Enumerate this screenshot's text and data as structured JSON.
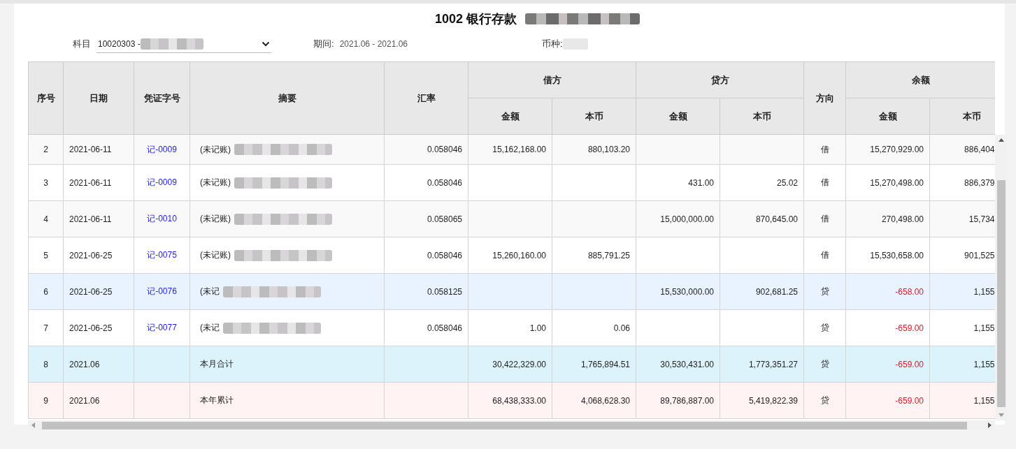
{
  "title": {
    "text": "1002 银行存款",
    "blurred": true
  },
  "filters": {
    "subject_label": "科目",
    "subject_value": "10020303 -",
    "subject_blurred": true,
    "period_label": "期间:",
    "period_value": "2021.06 - 2021.06",
    "currency_label": "币种:",
    "currency_blurred": true
  },
  "table": {
    "header": [
      {
        "label": "序号"
      },
      {
        "label": "日期"
      },
      {
        "label": "凭证字号"
      },
      {
        "label": "摘要"
      },
      {
        "label": "汇率"
      },
      {
        "label": "借方",
        "children": [
          "金额",
          "本币"
        ]
      },
      {
        "label": "贷方",
        "children": [
          "金额",
          "本币"
        ]
      },
      {
        "label": "方向"
      },
      {
        "label": "余额",
        "children": [
          "金额",
          "本币"
        ]
      }
    ],
    "rows": [
      {
        "kind": "entry",
        "selected": false,
        "no": "2",
        "date": "2021-06-11",
        "voucher": "记-0009",
        "summary": "(未记账)",
        "summary_blurred": true,
        "rate": "0.058046",
        "debit_amount": "15,162,168.00",
        "debit_base": "880,103.20",
        "credit_amount": "",
        "credit_base": "",
        "direction": "借",
        "balance_amount": "15,270,929.00",
        "balance_negative": false,
        "balance_base": "886,404"
      },
      {
        "kind": "entry",
        "selected": false,
        "no": "3",
        "date": "2021-06-11",
        "voucher": "记-0009",
        "summary": "(未记账)",
        "summary_blurred": true,
        "rate": "0.058046",
        "debit_amount": "",
        "debit_base": "",
        "credit_amount": "431.00",
        "credit_base": "25.02",
        "direction": "借",
        "balance_amount": "15,270,498.00",
        "balance_negative": false,
        "balance_base": "886,379"
      },
      {
        "kind": "entry",
        "selected": false,
        "no": "4",
        "date": "2021-06-11",
        "voucher": "记-0010",
        "summary": "(未记账)",
        "summary_blurred": true,
        "rate": "0.058065",
        "debit_amount": "",
        "debit_base": "",
        "credit_amount": "15,000,000.00",
        "credit_base": "870,645.00",
        "direction": "借",
        "balance_amount": "270,498.00",
        "balance_negative": false,
        "balance_base": "15,734"
      },
      {
        "kind": "entry",
        "selected": false,
        "no": "5",
        "date": "2021-06-25",
        "voucher": "记-0075",
        "summary": "(未记账)",
        "summary_blurred": true,
        "rate": "0.058046",
        "debit_amount": "15,260,160.00",
        "debit_base": "885,791.25",
        "credit_amount": "",
        "credit_base": "",
        "direction": "借",
        "balance_amount": "15,530,658.00",
        "balance_negative": false,
        "balance_base": "901,525"
      },
      {
        "kind": "entry",
        "selected": true,
        "no": "6",
        "date": "2021-06-25",
        "voucher": "记-0076",
        "summary": "(未记",
        "summary_blurred": true,
        "rate": "0.058125",
        "debit_amount": "",
        "debit_base": "",
        "credit_amount": "15,530,000.00",
        "credit_base": "902,681.25",
        "direction": "贷",
        "balance_amount": "-658.00",
        "balance_negative": true,
        "balance_base": "1,155"
      },
      {
        "kind": "entry",
        "selected": false,
        "no": "7",
        "date": "2021-06-25",
        "voucher": "记-0077",
        "summary": "(未记",
        "summary_blurred": true,
        "rate": "0.058046",
        "debit_amount": "1.00",
        "debit_base": "0.06",
        "credit_amount": "",
        "credit_base": "",
        "direction": "贷",
        "balance_amount": "-659.00",
        "balance_negative": true,
        "balance_base": "1,155"
      },
      {
        "kind": "month_total",
        "selected": false,
        "no": "8",
        "date": "2021.06",
        "voucher": "",
        "summary": "本月合计",
        "summary_blurred": false,
        "rate": "",
        "debit_amount": "30,422,329.00",
        "debit_base": "1,765,894.51",
        "credit_amount": "30,530,431.00",
        "credit_base": "1,773,351.27",
        "direction": "贷",
        "balance_amount": "-659.00",
        "balance_negative": true,
        "balance_base": "1,155"
      },
      {
        "kind": "year_total",
        "selected": false,
        "no": "9",
        "date": "2021.06",
        "voucher": "",
        "summary": "本年累计",
        "summary_blurred": false,
        "rate": "",
        "debit_amount": "68,438,333.00",
        "debit_base": "4,068,628.30",
        "credit_amount": "89,786,887.00",
        "credit_base": "5,419,822.39",
        "direction": "贷",
        "balance_amount": "-659.00",
        "balance_negative": true,
        "balance_base": "1,155"
      }
    ]
  }
}
